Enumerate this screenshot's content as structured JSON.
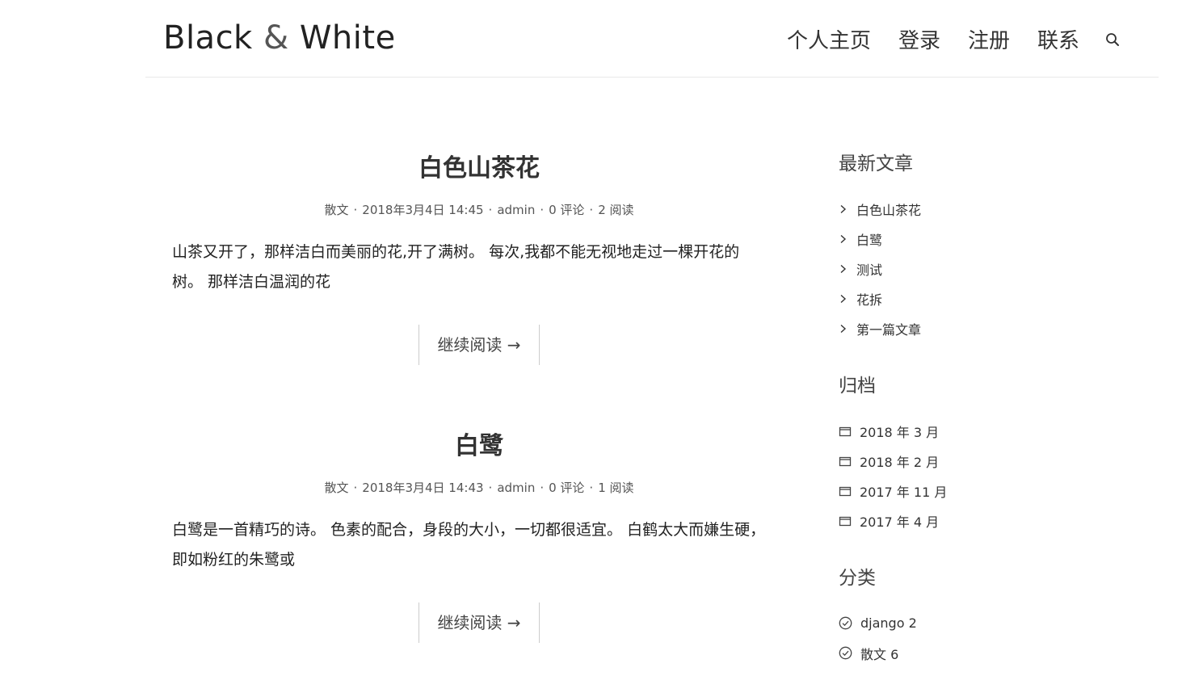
{
  "header": {
    "logo_part1": "Black",
    "logo_amp": "&",
    "logo_part2": "White",
    "nav": [
      "个人主页",
      "登录",
      "注册",
      "联系"
    ]
  },
  "posts": [
    {
      "title": "白色山茶花",
      "category": "散文",
      "datetime": "2018年3月4日 14:45",
      "author": "admin",
      "comments": "0 评论",
      "reads": "2 阅读",
      "excerpt": "山茶又开了，那样洁白而美丽的花,开了满树。 每次,我都不能无视地走过一棵开花的树。 那样洁白温润的花",
      "read_more": "继续阅读 →"
    },
    {
      "title": "白鹭",
      "category": "散文",
      "datetime": "2018年3月4日 14:43",
      "author": "admin",
      "comments": "0 评论",
      "reads": "1 阅读",
      "excerpt": "白鹭是一首精巧的诗。 色素的配合，身段的大小，一切都很适宜。 白鹤太大而嫌生硬，即如粉红的朱鹭或",
      "read_more": "继续阅读 →"
    }
  ],
  "sidebar": {
    "recent_title": "最新文章",
    "recent": [
      "白色山茶花",
      "白鹭",
      "测试",
      "花拆",
      "第一篇文章"
    ],
    "archive_title": "归档",
    "archives": [
      "2018 年 3 月",
      "2018 年 2 月",
      "2017 年 11 月",
      "2017 年 4 月"
    ],
    "category_title": "分类",
    "categories": [
      "django 2",
      "散文 6"
    ]
  },
  "icons": {
    "search": "search-icon",
    "recent_item": "chevron-right-icon",
    "archive_item": "calendar-icon",
    "category_item": "check-circle-icon"
  }
}
